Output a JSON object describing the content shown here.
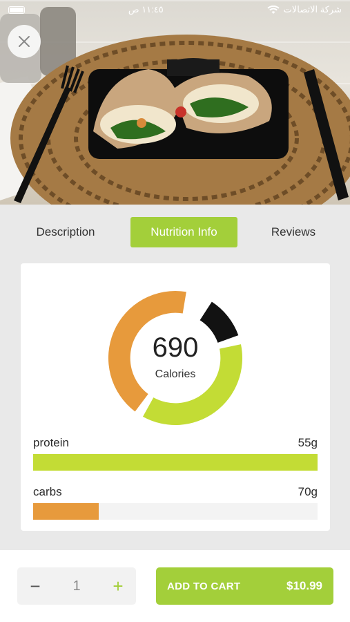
{
  "status_bar": {
    "carrier": "شركة الاتصالات",
    "time": "١١:٤٥ ص"
  },
  "hero": {
    "image_alt": "chicken wrap meal"
  },
  "tabs": [
    {
      "label": "Description",
      "active": false
    },
    {
      "label": "Nutrition Info",
      "active": true
    },
    {
      "label": "Reviews",
      "active": false
    }
  ],
  "nutrition": {
    "calories_value": "690",
    "calories_label": "Calories",
    "rows": [
      {
        "label": "protein",
        "value": "55g",
        "fill_fraction": 1.0,
        "color": "#c3dc35"
      },
      {
        "label": "carbs",
        "value": "70g",
        "fill_fraction": 0.23,
        "color": "#e79a3c"
      }
    ]
  },
  "chart_data": {
    "type": "pie",
    "variant": "donut",
    "center_value": "690",
    "center_label": "Calories",
    "slices": [
      {
        "value": 0.44,
        "color": "#e79a3c"
      },
      {
        "value": 0.12,
        "color": "#121212"
      },
      {
        "value": 0.38,
        "color": "#c3dc35"
      }
    ]
  },
  "cart": {
    "quantity": "1",
    "minus_symbol": "−",
    "plus_symbol": "+",
    "add_label": "ADD TO CART",
    "price": "$10.99"
  },
  "colors": {
    "accent": "#a3cf3a",
    "protein": "#c3dc35",
    "carbs": "#e79a3c",
    "fat": "#121212"
  }
}
